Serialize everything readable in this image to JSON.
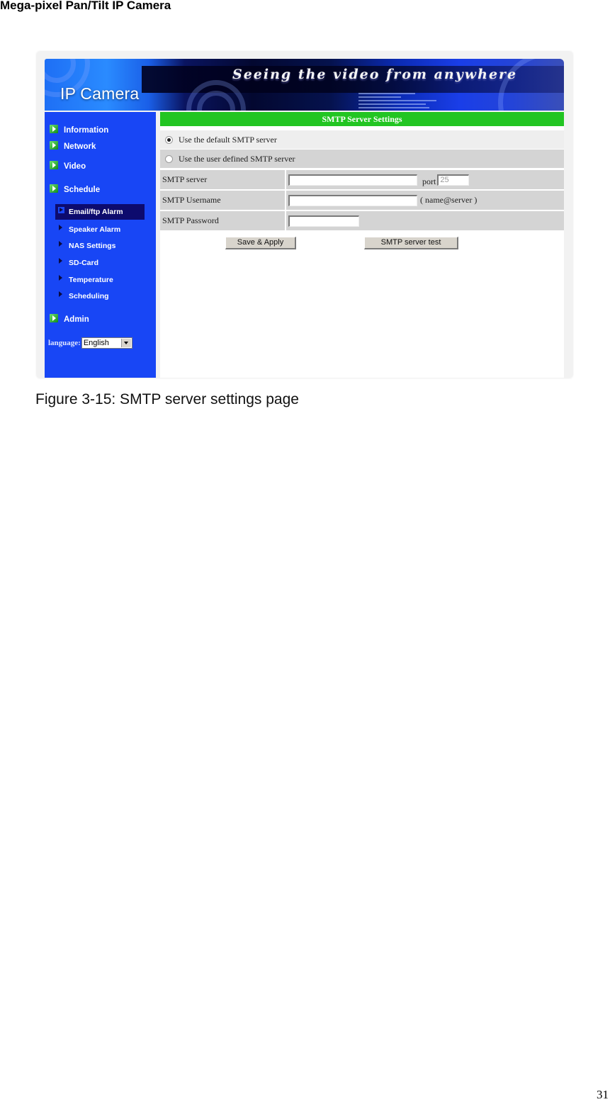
{
  "document": {
    "header": "Mega-pixel Pan/Tilt IP Camera",
    "caption": "Figure 3-15: SMTP server settings page",
    "page_number": "31"
  },
  "banner": {
    "logo": "IP Camera",
    "slogan": "Seeing the video from anywhere"
  },
  "sidebar": {
    "items": [
      {
        "label": "Information",
        "icon": "green-play-icon"
      },
      {
        "label": "Network",
        "icon": "green-play-icon"
      },
      {
        "label": "Video",
        "icon": "green-play-icon"
      },
      {
        "label": "Schedule",
        "icon": "green-play-icon"
      }
    ],
    "subitems": [
      {
        "label": "Email/ftp Alarm",
        "active": true
      },
      {
        "label": "Speaker Alarm"
      },
      {
        "label": "NAS Settings"
      },
      {
        "label": "SD-Card"
      },
      {
        "label": "Temperature"
      },
      {
        "label": "Scheduling"
      }
    ],
    "admin": {
      "label": "Admin",
      "icon": "green-play-icon"
    },
    "language": {
      "label": "language:",
      "selected": "English"
    }
  },
  "form": {
    "title": "SMTP Server Settings",
    "radio_default": {
      "label": "Use the default SMTP server",
      "checked": true
    },
    "radio_user": {
      "label": "Use the user defined SMTP server",
      "checked": false
    },
    "server": {
      "label": "SMTP server",
      "value": "",
      "port_label": "port",
      "port_value": "25"
    },
    "username": {
      "label": "SMTP Username",
      "value": "",
      "hint": "( name@server )"
    },
    "password": {
      "label": "SMTP Password",
      "value": ""
    },
    "buttons": {
      "save": "Save & Apply",
      "test": "SMTP server test"
    }
  },
  "colors": {
    "sidebar": "#1846f5",
    "active_item": "#0d0b6e",
    "title_bar": "#22c522",
    "row_dark": "#d4d4d4",
    "row_light": "#eeeeee"
  }
}
